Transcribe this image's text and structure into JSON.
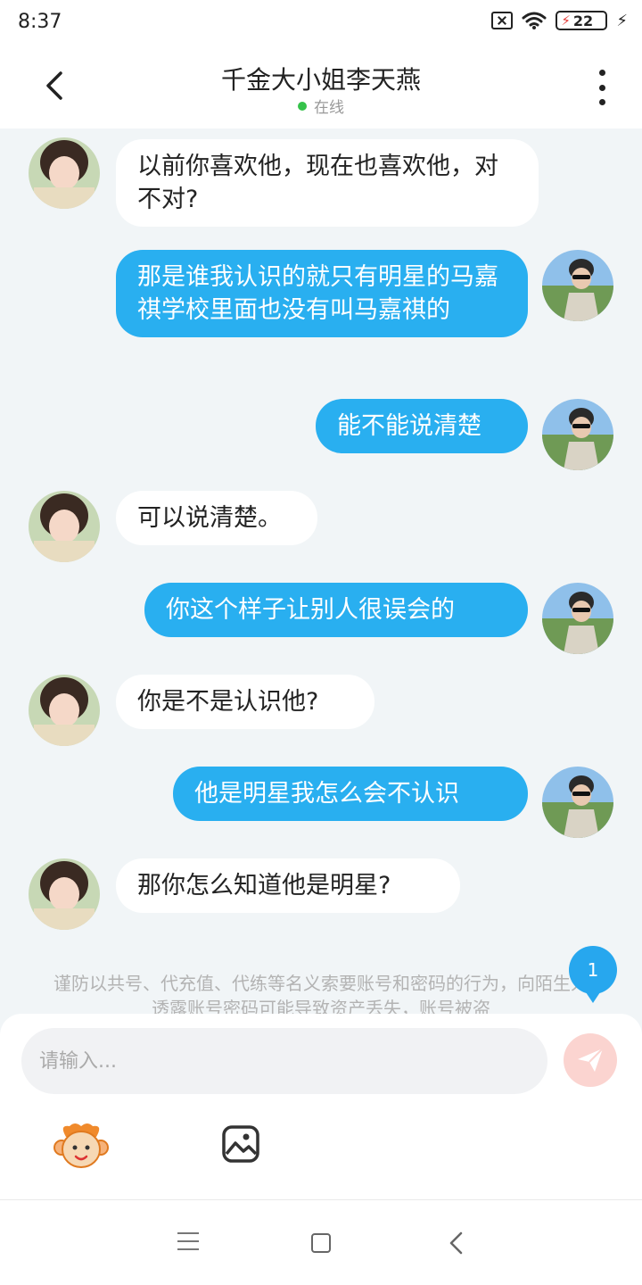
{
  "status_bar": {
    "time": "8:37",
    "battery": "22",
    "battery_icon": "charging-bolt-icon",
    "wifi_icon": "wifi-icon",
    "sim_icon": "no-sim-icon"
  },
  "header": {
    "title": "千金大小姐李天燕",
    "status": "在线",
    "status_color": "#35c24a"
  },
  "messages": [
    {
      "side": "in",
      "text": "以前你喜欢他，现在也喜欢他，对不对?"
    },
    {
      "side": "out",
      "text": "那是谁我认识的就只有明星的马嘉祺学校里面也没有叫马嘉祺的"
    },
    {
      "side": "out",
      "text": "能不能说清楚"
    },
    {
      "side": "in",
      "text": "可以说清楚。"
    },
    {
      "side": "out",
      "text": "你这个样子让别人很误会的"
    },
    {
      "side": "in",
      "text": "你是不是认识他?"
    },
    {
      "side": "out",
      "text": "他是明星我怎么会不认识"
    },
    {
      "side": "in",
      "text": "那你怎么知道他是明星?"
    }
  ],
  "notice": "谨防以共号、代充值、代练等名义索要账号和密码的行为，向陌生人透露账号密码可能导致资产丢失，账号被盗",
  "unread_badge": "1",
  "input": {
    "placeholder": "请输入..."
  },
  "colors": {
    "outgoing_bubble": "#29aff0",
    "incoming_bubble": "#ffffff",
    "background": "#f1f5f7",
    "send_button": "#fbd4d0"
  }
}
